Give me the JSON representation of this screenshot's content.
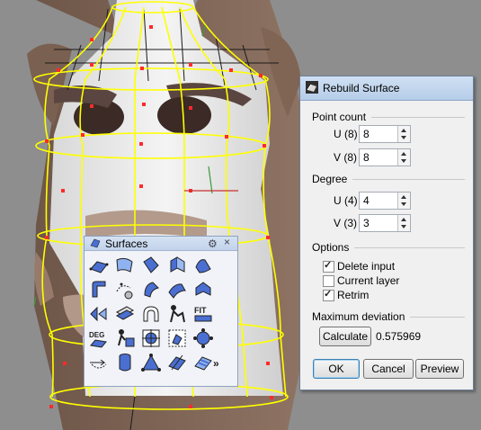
{
  "dialog": {
    "title": "Rebuild Surface",
    "point_count": {
      "label": "Point count",
      "u_label": "U (8)",
      "u_value": "8",
      "v_label": "V (8)",
      "v_value": "8"
    },
    "degree": {
      "label": "Degree",
      "u_label": "U (4)",
      "u_value": "4",
      "v_label": "V (3)",
      "v_value": "3"
    },
    "options": {
      "label": "Options",
      "delete_input": "Delete input",
      "current_layer": "Current layer",
      "retrim": "Retrim",
      "delete_input_checked": true,
      "current_layer_checked": false,
      "retrim_checked": true
    },
    "max_deviation": {
      "label": "Maximum deviation",
      "calculate": "Calculate",
      "value": "0.575969"
    },
    "buttons": {
      "ok": "OK",
      "cancel": "Cancel",
      "preview": "Preview"
    }
  },
  "toolbar": {
    "title": "Surfaces",
    "fit_label": "FIT",
    "deg_label": "DEG",
    "more_label": "»"
  },
  "colors": {
    "wireframe": "#ffff00",
    "points": "#ff0000",
    "viewport_bg": "#8e8e8e",
    "dialog_bg": "#f0f0f0",
    "tool_blue": "#4a6fd1"
  }
}
